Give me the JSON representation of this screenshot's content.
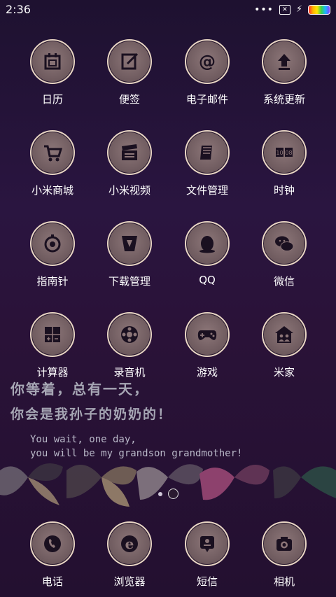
{
  "status_bar": {
    "time": "2:36",
    "dots": "•••",
    "sim_icon": "sim-x-icon",
    "charging_icon": "bolt-icon"
  },
  "apps": [
    {
      "label": "日历",
      "icon": "calendar-icon"
    },
    {
      "label": "便签",
      "icon": "note-icon"
    },
    {
      "label": "电子邮件",
      "icon": "at-sign-icon"
    },
    {
      "label": "系统更新",
      "icon": "upload-arrow-icon"
    },
    {
      "label": "小米商城",
      "icon": "shopping-cart-icon"
    },
    {
      "label": "小米视频",
      "icon": "clapperboard-icon"
    },
    {
      "label": "文件管理",
      "icon": "folder-notebook-icon"
    },
    {
      "label": "时钟",
      "icon": "clock-icon"
    },
    {
      "label": "指南针",
      "icon": "compass-icon"
    },
    {
      "label": "下载管理",
      "icon": "download-icon"
    },
    {
      "label": "QQ",
      "icon": "penguin-icon"
    },
    {
      "label": "微信",
      "icon": "chat-bubbles-icon"
    },
    {
      "label": "计算器",
      "icon": "calculator-icon"
    },
    {
      "label": "录音机",
      "icon": "recorder-icon"
    },
    {
      "label": "游戏",
      "icon": "gamepad-icon"
    },
    {
      "label": "米家",
      "icon": "home-people-icon"
    }
  ],
  "wallpaper_text": {
    "line1": "你等着，总有一天，",
    "line2": "你会是我孙子的奶奶的！",
    "line3": "You wait, one day,",
    "line4": "you will be my grandson grandmother!"
  },
  "dock": [
    {
      "label": "电话",
      "icon": "phone-icon"
    },
    {
      "label": "浏览器",
      "icon": "browser-e-icon"
    },
    {
      "label": "短信",
      "icon": "sms-icon"
    },
    {
      "label": "相机",
      "icon": "camera-icon"
    }
  ]
}
